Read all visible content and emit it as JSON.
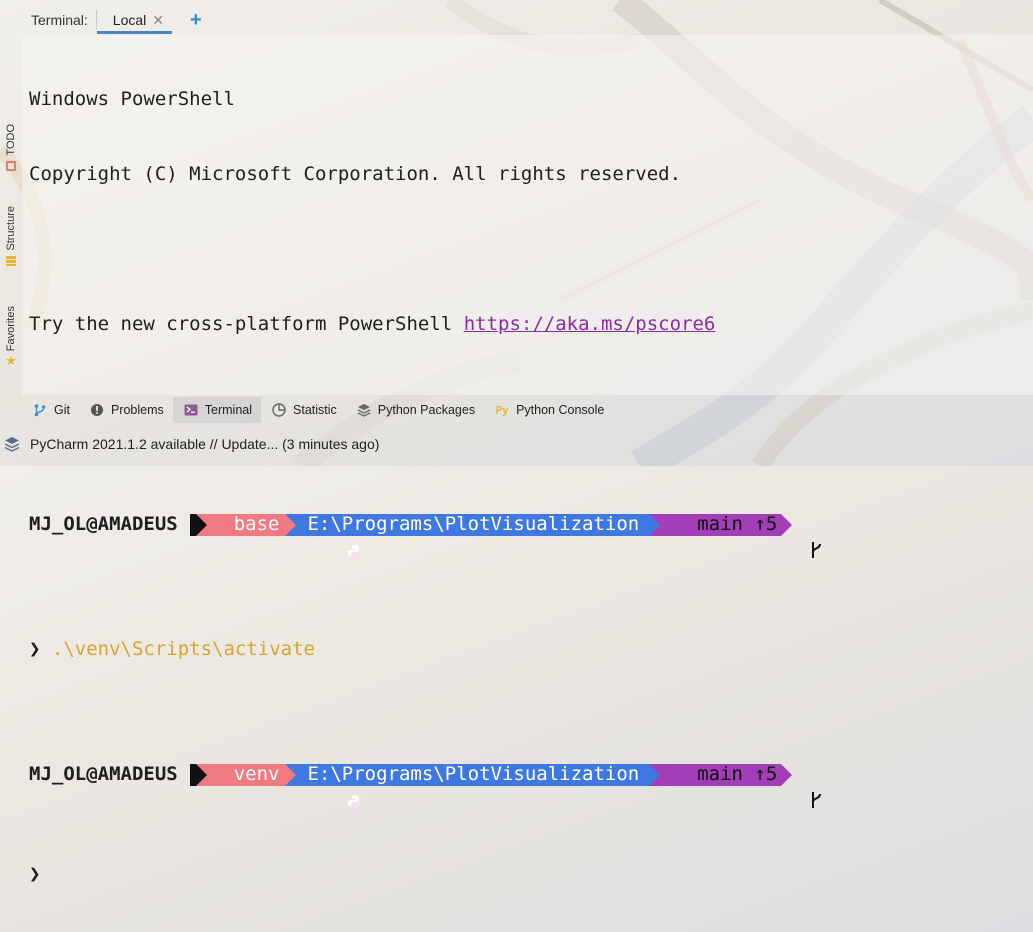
{
  "terminal": {
    "header_label": "Terminal:",
    "tab_label": "Local",
    "banner": [
      "Windows PowerShell",
      "Copyright (C) Microsoft Corporation. All rights reserved."
    ],
    "try_prefix": "Try the new cross-platform PowerShell ",
    "try_link": "https://aka.ms/pscore6",
    "prompt1": {
      "user": "MJ_OL@AMADEUS",
      "env": "base",
      "path": "E:\\Programs\\PlotVisualization",
      "branch": "main ↑5"
    },
    "command_arrow": "❯",
    "command": " .\\venv\\Scripts\\activate",
    "prompt2": {
      "user": "MJ_OL@AMADEUS",
      "env": "venv",
      "path": "E:\\Programs\\PlotVisualization",
      "branch": "main ↑5"
    },
    "cursor_arrow": "❯"
  },
  "left_strip": {
    "todo": "TODO",
    "structure": "Structure",
    "favorites": "Favorites"
  },
  "tool_windows": [
    {
      "label": "Git",
      "icon": "git-branch-icon"
    },
    {
      "label": "Problems",
      "icon": "problems-icon"
    },
    {
      "label": "Terminal",
      "icon": "terminal-icon"
    },
    {
      "label": "Statistic",
      "icon": "statistic-icon"
    },
    {
      "label": "Python Packages",
      "icon": "layers-icon"
    },
    {
      "label": "Python Console",
      "icon": "python-console-icon"
    }
  ],
  "status": {
    "message": "PyCharm 2021.1.2 available // Update... (3 minutes ago)"
  },
  "colors": {
    "env_segment": "#f07a82",
    "path_segment": "#3f78e0",
    "git_segment": "#a23fb8",
    "command": "#d6a52b",
    "link": "#8a2ca0",
    "accent": "#4a88c7"
  }
}
